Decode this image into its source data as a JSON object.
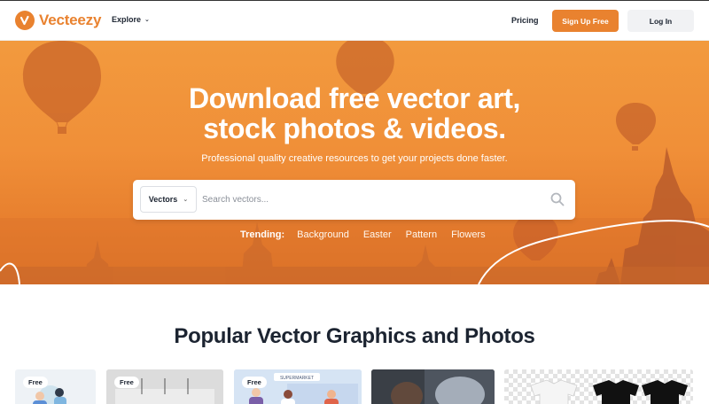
{
  "header": {
    "logo_text": "Vecteezy",
    "explore_label": "Explore",
    "pricing_label": "Pricing",
    "signup_label": "Sign Up Free",
    "login_label": "Log In"
  },
  "hero": {
    "headline_line1": "Download free vector art,",
    "headline_line2": "stock photos & videos.",
    "subhead": "Professional quality creative resources to get your projects done faster.",
    "search": {
      "type_selected": "Vectors",
      "placeholder": "Search vectors..."
    },
    "trending": {
      "label": "Trending:",
      "items": [
        "Background",
        "Easter",
        "Pattern",
        "Flowers"
      ]
    }
  },
  "section": {
    "title": "Popular Vector Graphics and Photos",
    "cards": [
      {
        "badge": "Free"
      },
      {
        "badge": "Free"
      },
      {
        "badge": "Free",
        "caption": "SUPERMARKET"
      },
      {},
      {}
    ]
  },
  "colors": {
    "brand": "#e9822f",
    "text_dark": "#1c2431"
  },
  "icons": [
    "vecteezy-logo-icon",
    "chevron-down-icon",
    "search-icon"
  ]
}
